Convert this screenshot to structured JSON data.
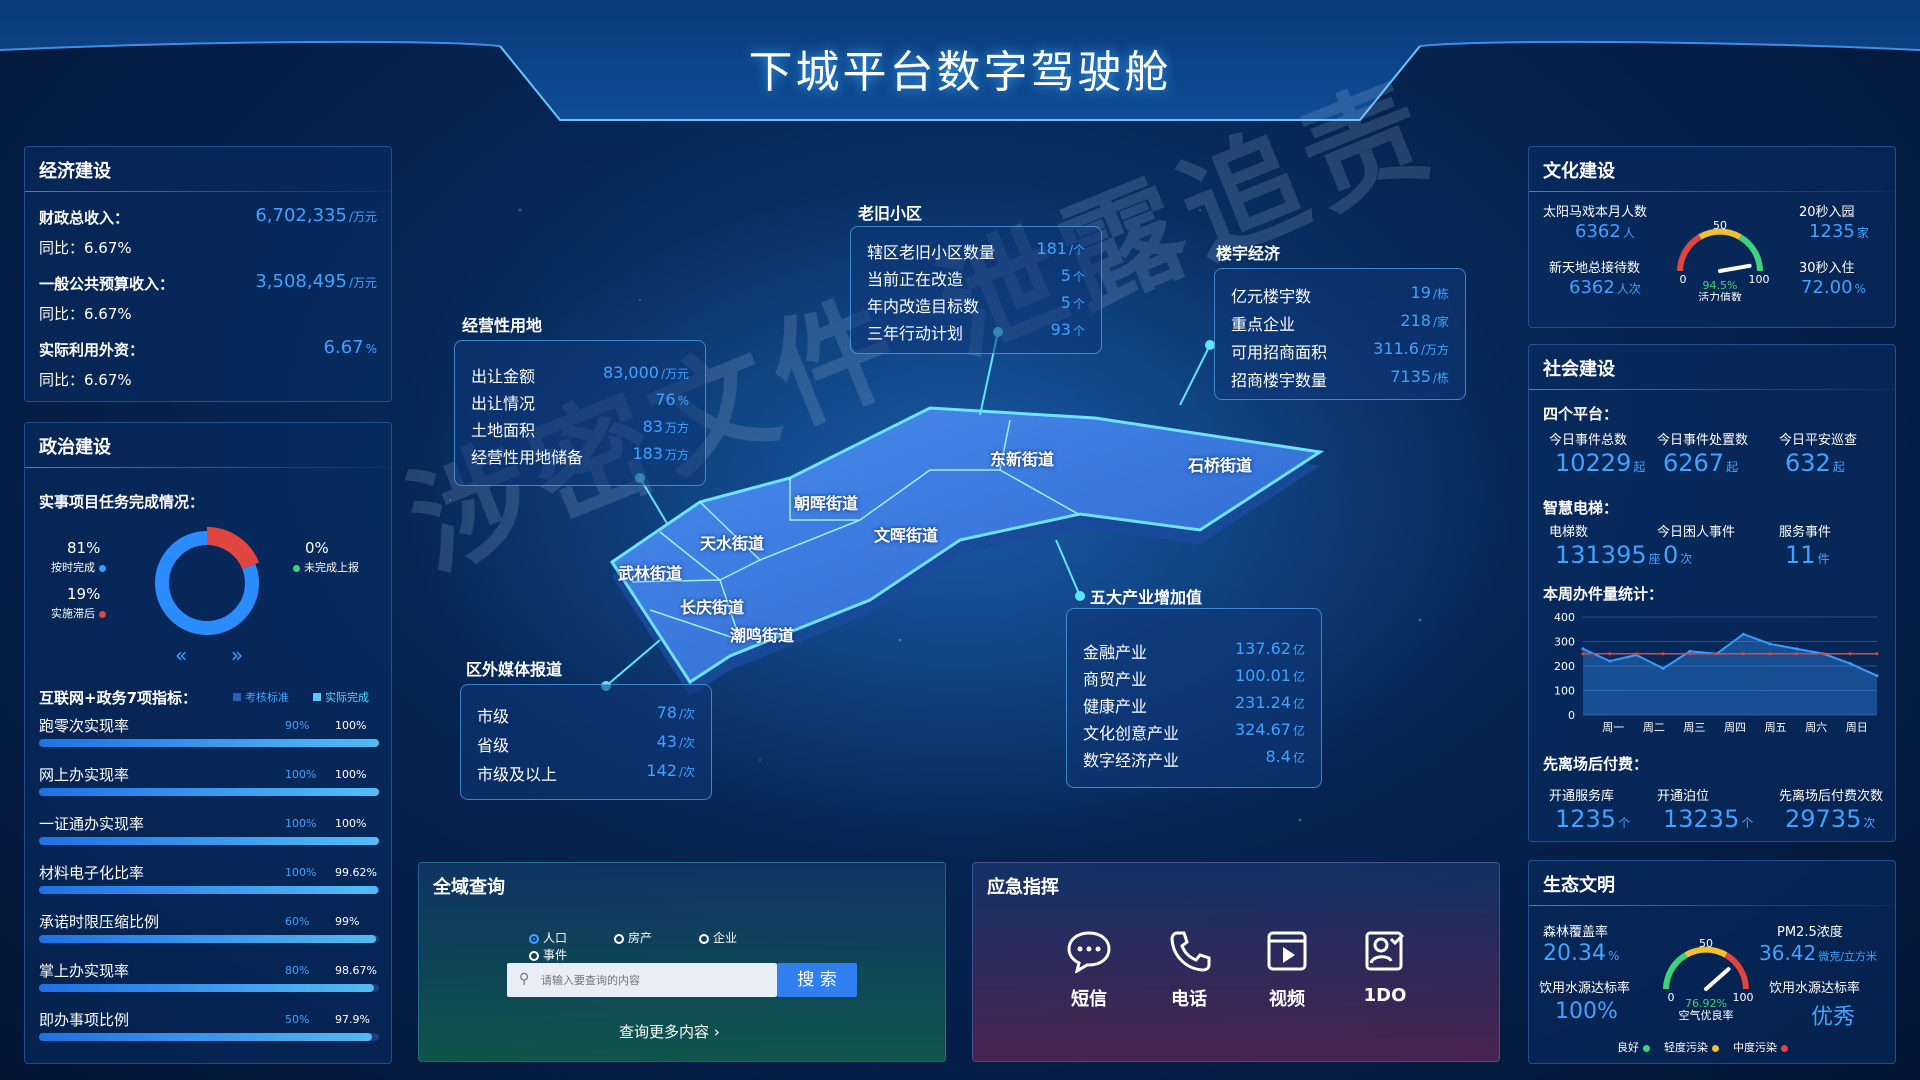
{
  "header": {
    "title": "下城平台数字驾驶舱"
  },
  "watermark": "涉密文件 泄露追责",
  "economy": {
    "title": "经济建设",
    "items": [
      {
        "label": "财政总收入：",
        "value": "6,702,335",
        "unit": "/万元",
        "yoy": "同比：6.67%"
      },
      {
        "label": "一般公共预算收入：",
        "value": "3,508,495",
        "unit": "/万元",
        "yoy": "同比：6.67%"
      },
      {
        "label": "实际利用外资：",
        "value": "6.67",
        "unit": "%",
        "yoy": "同比：6.67%"
      }
    ]
  },
  "politics": {
    "title": "政治建设",
    "task_title": "实事项目任务完成情况：",
    "donut": {
      "on_time_pct": "81%",
      "on_time_label": "按时完成",
      "delayed_pct": "19%",
      "delayed_label": "实施滞后",
      "unreported_pct": "0%",
      "unreported_label": "未完成上报",
      "on_time_value": 81,
      "delayed_value": 19
    },
    "nav_prev": "«",
    "nav_next": "»",
    "metrics_title": "互联网+政务7项指标：",
    "legend_standard": "考核标准",
    "legend_actual": "实际完成",
    "metrics": [
      {
        "name": "跑零次实现率",
        "standard": "90%",
        "actual": "100%",
        "standard_value": 90,
        "actual_value": 100
      },
      {
        "name": "网上办实现率",
        "standard": "100%",
        "actual": "100%",
        "standard_value": 100,
        "actual_value": 100
      },
      {
        "name": "一证通办实现率",
        "standard": "100%",
        "actual": "100%",
        "standard_value": 100,
        "actual_value": 100
      },
      {
        "name": "材料电子化比率",
        "standard": "100%",
        "actual": "99.62%",
        "standard_value": 100,
        "actual_value": 99.62
      },
      {
        "name": "承诺时限压缩比例",
        "standard": "60%",
        "actual": "99%",
        "standard_value": 60,
        "actual_value": 99
      },
      {
        "name": "掌上办实现率",
        "standard": "80%",
        "actual": "98.67%",
        "standard_value": 80,
        "actual_value": 98.67
      },
      {
        "name": "即办事项比例",
        "standard": "50%",
        "actual": "97.9%",
        "standard_value": 50,
        "actual_value": 97.9
      }
    ]
  },
  "map": {
    "districts": [
      "东新街道",
      "石桥街道",
      "朝晖街道",
      "天水街道",
      "文晖街道",
      "武林街道",
      "长庆街道",
      "潮鸣街道"
    ],
    "old_community": {
      "title": "老旧小区",
      "rows": [
        {
          "label": "辖区老旧小区数量",
          "value": "181",
          "unit": "/个"
        },
        {
          "label": "当前正在改造",
          "value": "5",
          "unit": "个"
        },
        {
          "label": "年内改造目标数",
          "value": "5",
          "unit": "个"
        },
        {
          "label": "三年行动计划",
          "value": "93",
          "unit": "个"
        }
      ]
    },
    "building_economy": {
      "title": "楼宇经济",
      "rows": [
        {
          "label": "亿元楼宇数",
          "value": "19",
          "unit": "/栋"
        },
        {
          "label": "重点企业",
          "value": "218",
          "unit": "/家"
        },
        {
          "label": "可用招商面积",
          "value": "311.6",
          "unit": "/万方"
        },
        {
          "label": "招商楼宇数量",
          "value": "7135",
          "unit": "/栋"
        }
      ]
    },
    "land": {
      "title": "经营性用地",
      "rows": [
        {
          "label": "出让金额",
          "value": "83,000",
          "unit": "/万元"
        },
        {
          "label": "出让情况",
          "value": "76",
          "unit": "%"
        },
        {
          "label": "土地面积",
          "value": "83",
          "unit": "万方"
        },
        {
          "label": "经营性用地储备",
          "value": "183",
          "unit": "万方"
        }
      ]
    },
    "industry": {
      "title": "五大产业增加值",
      "rows": [
        {
          "label": "金融产业",
          "value": "137.62",
          "unit": "亿"
        },
        {
          "label": "商贸产业",
          "value": "100.01",
          "unit": "亿"
        },
        {
          "label": "健康产业",
          "value": "231.24",
          "unit": "亿"
        },
        {
          "label": "文化创意产业",
          "value": "324.67",
          "unit": "亿"
        },
        {
          "label": "数字经济产业",
          "value": "8.4",
          "unit": "亿"
        }
      ]
    },
    "media": {
      "title": "区外媒体报道",
      "rows": [
        {
          "label": "市级",
          "value": "78",
          "unit": "/次"
        },
        {
          "label": "省级",
          "value": "43",
          "unit": "/次"
        },
        {
          "label": "市级及以上",
          "value": "142",
          "unit": "/次"
        }
      ]
    }
  },
  "search": {
    "title": "全域查询",
    "options": [
      "人口",
      "房产",
      "企业",
      "事件"
    ],
    "selected": "人口",
    "placeholder": "请输入要查询的内容",
    "button": "搜 索",
    "more": "查询更多内容 ›"
  },
  "emergency": {
    "title": "应急指挥",
    "buttons": [
      {
        "label": "短信",
        "icon": "chat-bubble-icon"
      },
      {
        "label": "电话",
        "icon": "phone-icon"
      },
      {
        "label": "视频",
        "icon": "video-icon"
      },
      {
        "label": "1DO",
        "icon": "person-check-icon"
      }
    ]
  },
  "culture": {
    "title": "文化建设",
    "left_top_label": "太阳马戏本月人数",
    "left_top_value": "6362",
    "left_top_unit": "人",
    "left_bottom_label": "新天地总接待数",
    "left_bottom_value": "6362",
    "left_bottom_unit": "人次",
    "right_top_label": "20秒入园",
    "right_top_value": "1235",
    "right_top_unit": "家",
    "right_bottom_label": "30秒入住",
    "right_bottom_value": "72.00",
    "right_bottom_unit": "%",
    "gauge": {
      "max_label": "100",
      "mid_label": "50",
      "min_label": "0",
      "value_text": "94.5%",
      "caption": "活力值数",
      "value": 94.5
    }
  },
  "social": {
    "title": "社会建设",
    "four_platforms": "四个平台：",
    "platform_stats": [
      {
        "label": "今日事件总数",
        "value": "10229",
        "unit": "起"
      },
      {
        "label": "今日事件处置数",
        "value": "6267",
        "unit": "起"
      },
      {
        "label": "今日平安巡查",
        "value": "632",
        "unit": "起"
      }
    ],
    "elevator_title": "智慧电梯：",
    "elevator_stats": [
      {
        "label": "电梯数",
        "value": "131395",
        "unit": "座"
      },
      {
        "label": "今日困人事件",
        "value": "0",
        "unit": "次"
      },
      {
        "label": "服务事件",
        "value": "11",
        "unit": "件"
      }
    ],
    "weekly_title": "本周办件量统计：",
    "parking_title": "先离场后付费：",
    "parking_stats": [
      {
        "label": "开通服务库",
        "value": "1235",
        "unit": "个"
      },
      {
        "label": "开通泊位",
        "value": "13235",
        "unit": "个"
      },
      {
        "label": "先离场后付费次数",
        "value": "29735",
        "unit": "次"
      }
    ]
  },
  "chart_data": {
    "type": "line",
    "categories": [
      "周一",
      "周二",
      "周三",
      "周四",
      "周五",
      "周六",
      "周日"
    ],
    "series": [
      {
        "values": [
          270,
          220,
          245,
          190,
          260,
          250,
          330,
          290,
          270,
          250,
          210,
          160
        ]
      },
      {
        "values": [
          250,
          250,
          250,
          250,
          250,
          250,
          250,
          250,
          250,
          250,
          250,
          250
        ]
      }
    ],
    "yticks": [
      "0",
      "100",
      "200",
      "300",
      "400"
    ],
    "ylim": [
      0,
      400
    ],
    "colors": [
      "#3a9bff",
      "#e0453f"
    ]
  },
  "ecology": {
    "title": "生态文明",
    "forest_label": "森林覆盖率",
    "forest_value": "20.34",
    "forest_unit": "%",
    "water_left_label": "饮用水源达标率",
    "water_left_value": "100%",
    "pm_label": "PM2.5浓度",
    "pm_value": "36.42",
    "pm_unit": "微克/立方米",
    "water_right_label": "饮用水源达标率",
    "water_right_value": "优秀",
    "gauge": {
      "max_label": "100",
      "mid_label": "50",
      "min_label": "0",
      "value_text": "76.92%",
      "caption": "空气优良率",
      "value": 76.92
    },
    "legend": [
      {
        "label": "良好",
        "color": "#3ed37a"
      },
      {
        "label": "轻度污染",
        "color": "#f0c030"
      },
      {
        "label": "中度污染",
        "color": "#e04545"
      }
    ]
  }
}
